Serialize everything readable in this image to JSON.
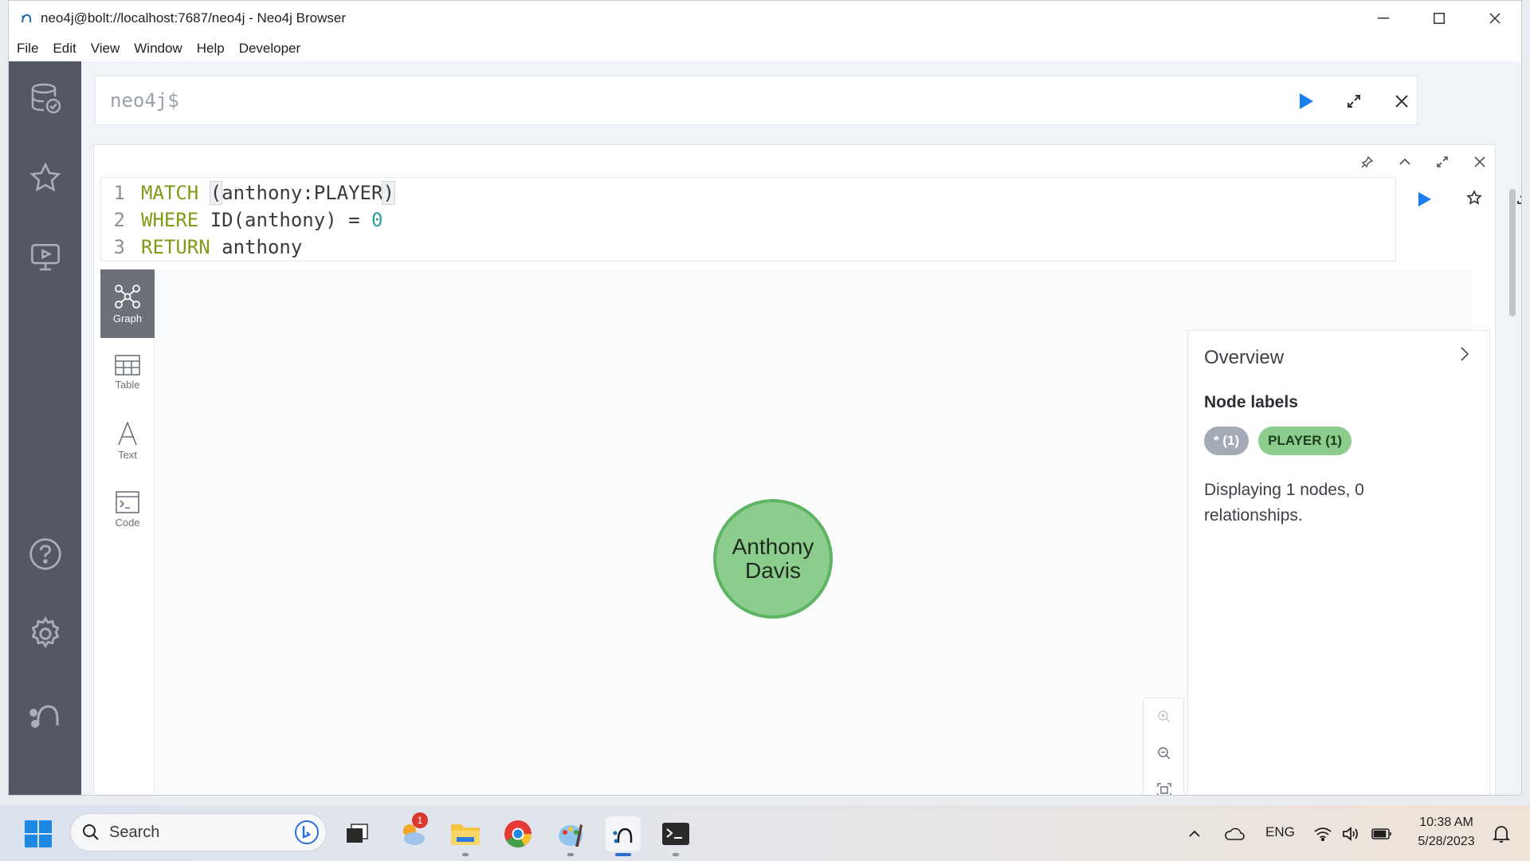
{
  "window": {
    "title": "neo4j@bolt://localhost:7687/neo4j - Neo4j Browser"
  },
  "menu": {
    "items": [
      "File",
      "Edit",
      "View",
      "Window",
      "Help",
      "Developer"
    ]
  },
  "sidebar": {
    "icons": [
      "database-icon",
      "favorites-star-icon",
      "guides-monitor-icon",
      "help-icon",
      "settings-gear-icon",
      "neo4j-logo-icon"
    ]
  },
  "editor": {
    "prompt": "neo4j$"
  },
  "frame": {
    "code_lines": [
      {
        "num": "1",
        "tokens": [
          {
            "t": "MATCH",
            "c": "kw"
          },
          {
            "t": " ",
            "c": "txt"
          },
          {
            "t": "(",
            "c": "bracket"
          },
          {
            "t": "anthony:PLAYER",
            "c": "txt"
          },
          {
            "t": ")",
            "c": "bracket"
          }
        ]
      },
      {
        "num": "2",
        "tokens": [
          {
            "t": "WHERE",
            "c": "kw"
          },
          {
            "t": " ID(anthony) = ",
            "c": "txt"
          },
          {
            "t": "0",
            "c": "num"
          }
        ]
      },
      {
        "num": "3",
        "tokens": [
          {
            "t": "RETURN",
            "c": "kw"
          },
          {
            "t": " anthony",
            "c": "txt"
          }
        ]
      }
    ],
    "view_tabs": [
      {
        "label": "Graph",
        "active": true
      },
      {
        "label": "Table",
        "active": false
      },
      {
        "label": "Text",
        "active": false
      },
      {
        "label": "Code",
        "active": false
      }
    ]
  },
  "graph": {
    "node": {
      "line1": "Anthony",
      "line2": "Davis",
      "fill": "#8ccc8d",
      "border": "#5db462"
    }
  },
  "overview": {
    "title": "Overview",
    "node_labels_heading": "Node labels",
    "labels": [
      {
        "text": "* (1)",
        "color": "#a5abb6"
      },
      {
        "text": "PLAYER (1)",
        "color": "#8ccc8d"
      }
    ],
    "summary": "Displaying 1 nodes, 0 relationships."
  },
  "taskbar": {
    "search_label": "Search",
    "lang": "ENG",
    "time": "10:38 AM",
    "date": "5/28/2023",
    "weather_badge": "1"
  },
  "colors": {
    "accent_blue": "#1a7ef0",
    "sidebar_bg": "#535864"
  }
}
